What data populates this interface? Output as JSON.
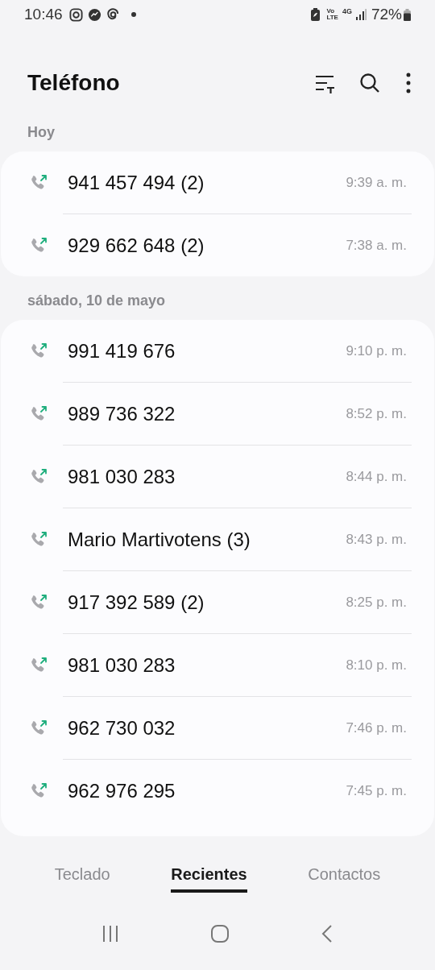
{
  "status_bar": {
    "time": "10:46",
    "network_top": "Vo",
    "network_bottom": "LTE",
    "data_type": "4G",
    "battery": "72%"
  },
  "header": {
    "title": "Teléfono"
  },
  "sections": [
    {
      "label": "Hoy",
      "calls": [
        {
          "kind": "outgoing",
          "name": "941 457 494 (2)",
          "time": "9:39 a. m."
        },
        {
          "kind": "outgoing",
          "name": "929 662 648 (2)",
          "time": "7:38 a. m."
        }
      ]
    },
    {
      "label": "sábado, 10 de mayo",
      "calls": [
        {
          "kind": "outgoing",
          "name": "991 419 676",
          "time": "9:10 p. m."
        },
        {
          "kind": "outgoing",
          "name": "989 736 322",
          "time": "8:52 p. m."
        },
        {
          "kind": "outgoing",
          "name": "981 030 283",
          "time": "8:44 p. m."
        },
        {
          "kind": "outgoing",
          "name": "Mario Martivotens (3)",
          "time": "8:43 p. m."
        },
        {
          "kind": "outgoing",
          "name": "917 392 589 (2)",
          "time": "8:25 p. m."
        },
        {
          "kind": "outgoing",
          "name": "981 030 283",
          "time": "8:10 p. m."
        },
        {
          "kind": "outgoing",
          "name": "962 730 032",
          "time": "7:46 p. m."
        },
        {
          "kind": "outgoing",
          "name": "962 976 295",
          "time": "7:45 p. m."
        }
      ]
    }
  ],
  "tabs": [
    {
      "label": "Teclado",
      "selected": false
    },
    {
      "label": "Recientes",
      "selected": true
    },
    {
      "label": "Contactos",
      "selected": false
    }
  ]
}
